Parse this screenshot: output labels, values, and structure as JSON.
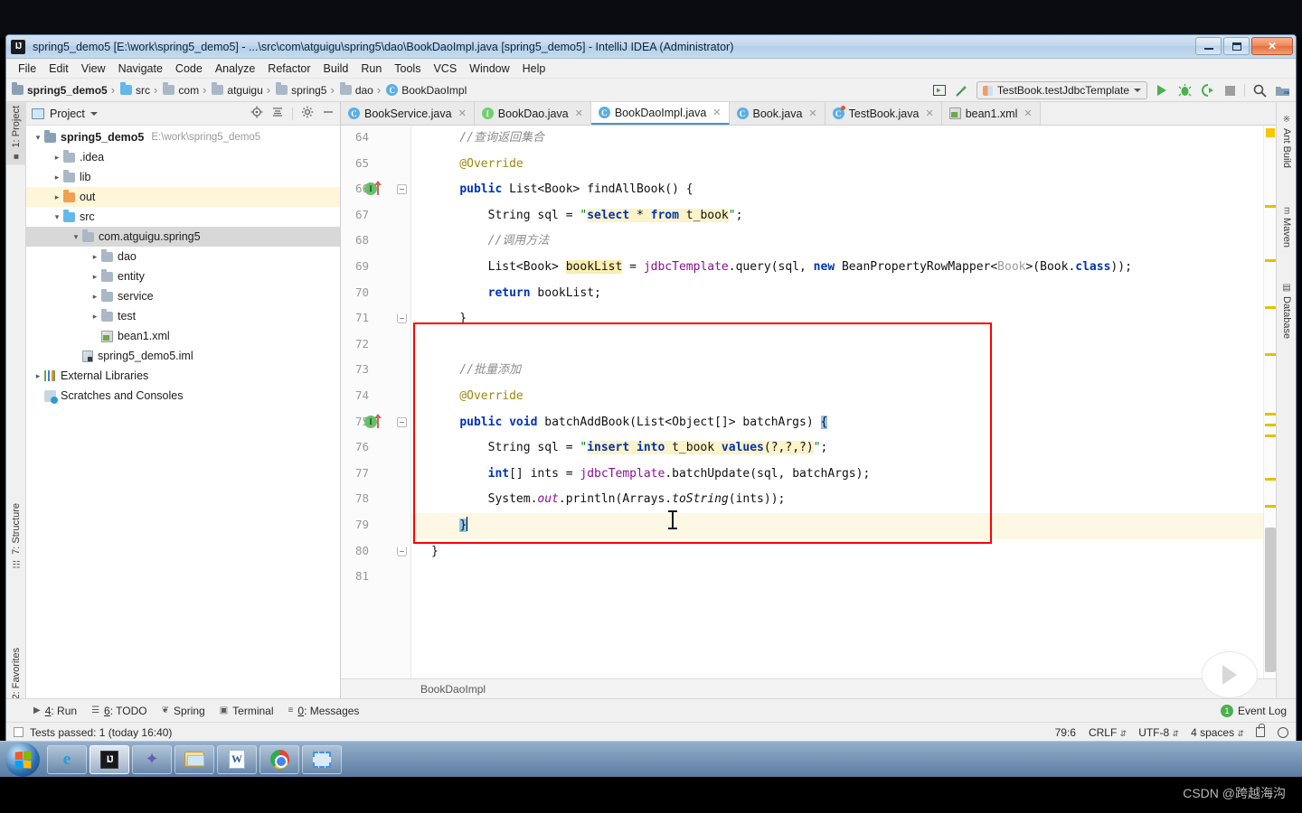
{
  "window": {
    "title": "spring5_demo5 [E:\\work\\spring5_demo5] - ...\\src\\com\\atguigu\\spring5\\dao\\BookDaoImpl.java [spring5_demo5] - IntelliJ IDEA (Administrator)",
    "logo_text": "IJ",
    "minimize_label": "–",
    "maximize_label": "❐",
    "close_label": "✕"
  },
  "menubar": {
    "items": [
      "File",
      "Edit",
      "View",
      "Navigate",
      "Code",
      "Analyze",
      "Refactor",
      "Build",
      "Run",
      "Tools",
      "VCS",
      "Window",
      "Help"
    ]
  },
  "breadcrumb": {
    "items": [
      {
        "label": "spring5_demo5",
        "icon": "project-module-icon"
      },
      {
        "label": "src",
        "icon": "source-folder-icon"
      },
      {
        "label": "com",
        "icon": "package-icon"
      },
      {
        "label": "atguigu",
        "icon": "package-icon"
      },
      {
        "label": "spring5",
        "icon": "package-icon"
      },
      {
        "label": "dao",
        "icon": "package-icon"
      },
      {
        "label": "BookDaoImpl",
        "icon": "class-icon"
      }
    ]
  },
  "toolbar": {
    "run_config": "TestBook.testJdbcTemplate",
    "run_tooltip": "Run",
    "debug_tooltip": "Debug",
    "coverage_tooltip": "Run with Coverage",
    "stop_tooltip": "Stop",
    "search_tooltip": "Search Everywhere",
    "project_structure_tooltip": "Project Structure"
  },
  "left_strip": {
    "items": [
      "1: Project",
      "7: Structure",
      "2: Favorites"
    ]
  },
  "right_strip": {
    "items": [
      "Ant Build",
      "Maven",
      "Database"
    ]
  },
  "project_panel": {
    "title": "Project",
    "actions": [
      "locate-icon",
      "collapse-all-icon",
      "settings-icon",
      "hide-icon"
    ],
    "tree": [
      {
        "label": "spring5_demo5",
        "sub": "E:\\work\\spring5_demo5",
        "arrow": "v",
        "indent": 0,
        "icon": "module-icon",
        "bold": true,
        "state": "normal"
      },
      {
        "label": ".idea",
        "sub": "",
        "arrow": ">",
        "indent": 1,
        "icon": "folder-gray",
        "bold": false,
        "state": "normal"
      },
      {
        "label": "lib",
        "sub": "",
        "arrow": ">",
        "indent": 1,
        "icon": "folder-gray",
        "bold": false,
        "state": "normal"
      },
      {
        "label": "out",
        "sub": "",
        "arrow": ">",
        "indent": 1,
        "icon": "folder-orange",
        "bold": false,
        "state": "highlight"
      },
      {
        "label": "src",
        "sub": "",
        "arrow": "v",
        "indent": 1,
        "icon": "folder-blue",
        "bold": false,
        "state": "normal"
      },
      {
        "label": "com.atguigu.spring5",
        "sub": "",
        "arrow": "v",
        "indent": 2,
        "icon": "package-icon",
        "bold": false,
        "state": "selected"
      },
      {
        "label": "dao",
        "sub": "",
        "arrow": ">",
        "indent": 3,
        "icon": "package-icon",
        "bold": false,
        "state": "normal"
      },
      {
        "label": "entity",
        "sub": "",
        "arrow": ">",
        "indent": 3,
        "icon": "package-icon",
        "bold": false,
        "state": "normal"
      },
      {
        "label": "service",
        "sub": "",
        "arrow": ">",
        "indent": 3,
        "icon": "package-icon",
        "bold": false,
        "state": "normal"
      },
      {
        "label": "test",
        "sub": "",
        "arrow": ">",
        "indent": 3,
        "icon": "package-icon",
        "bold": false,
        "state": "normal"
      },
      {
        "label": "bean1.xml",
        "sub": "",
        "arrow": "",
        "indent": 3,
        "icon": "xml-icon",
        "bold": false,
        "state": "normal"
      },
      {
        "label": "spring5_demo5.iml",
        "sub": "",
        "arrow": "",
        "indent": 2,
        "icon": "iml-icon",
        "bold": false,
        "state": "normal"
      },
      {
        "label": "External Libraries",
        "sub": "",
        "arrow": ">",
        "indent": 0,
        "icon": "libraries-icon",
        "bold": false,
        "state": "normal"
      },
      {
        "label": "Scratches and Consoles",
        "sub": "",
        "arrow": "",
        "indent": 0,
        "icon": "scratches-icon",
        "bold": false,
        "state": "normal"
      }
    ]
  },
  "editor": {
    "tabs": [
      {
        "label": "BookService.java",
        "icon": "class-icon",
        "active": false
      },
      {
        "label": "BookDao.java",
        "icon": "interface-icon",
        "active": false
      },
      {
        "label": "BookDaoImpl.java",
        "icon": "class-icon",
        "active": true
      },
      {
        "label": "Book.java",
        "icon": "class-icon",
        "active": false
      },
      {
        "label": "TestBook.java",
        "icon": "test-class-icon",
        "active": false
      },
      {
        "label": "bean1.xml",
        "icon": "xml-icon",
        "active": false
      }
    ],
    "breadcrumb_bottom": "BookDaoImpl",
    "line_numbers": [
      "64",
      "65",
      "66",
      "67",
      "68",
      "69",
      "70",
      "71",
      "72",
      "73",
      "74",
      "75",
      "76",
      "77",
      "78",
      "79",
      "80",
      "81"
    ],
    "lines": [
      {
        "n": "64",
        "text": "    //查询返回集合"
      },
      {
        "n": "65",
        "text": "    @Override"
      },
      {
        "n": "66",
        "text": "    public List<Book> findAllBook() {"
      },
      {
        "n": "67",
        "text": "        String sql = \"select * from t_book\";"
      },
      {
        "n": "68",
        "text": "        //调用方法"
      },
      {
        "n": "69",
        "text": "        List<Book> bookList = jdbcTemplate.query(sql, new BeanPropertyRowMapper<Book>(Book.class));"
      },
      {
        "n": "70",
        "text": "        return bookList;"
      },
      {
        "n": "71",
        "text": "    }"
      },
      {
        "n": "72",
        "text": ""
      },
      {
        "n": "73",
        "text": "    //批量添加"
      },
      {
        "n": "74",
        "text": "    @Override"
      },
      {
        "n": "75",
        "text": "    public void batchAddBook(List<Object[]> batchArgs) {"
      },
      {
        "n": "76",
        "text": "        String sql = \"insert into t_book values(?,?,?)\";"
      },
      {
        "n": "77",
        "text": "        int[] ints = jdbcTemplate.batchUpdate(sql, batchArgs);"
      },
      {
        "n": "78",
        "text": "        System.out.println(Arrays.toString(ints));"
      },
      {
        "n": "79",
        "text": "    }"
      },
      {
        "n": "80",
        "text": "}"
      },
      {
        "n": "81",
        "text": ""
      }
    ],
    "annotation_color": "#9e880d",
    "keyword_color": "#0033b3",
    "comment_color": "#8c8c8c",
    "string_highlight_color": "#fdf3c9",
    "red_box_color": "#ff0000"
  },
  "bottom_strip": {
    "items": [
      {
        "key": "4",
        "label": "Run",
        "icon": "run-icon"
      },
      {
        "key": "6",
        "label": "TODO",
        "icon": "todo-icon"
      },
      {
        "key": "",
        "label": "Spring",
        "icon": "spring-leaf-icon"
      },
      {
        "key": "",
        "label": "Terminal",
        "icon": "terminal-icon"
      },
      {
        "key": "0",
        "label": "Messages",
        "icon": "messages-icon"
      }
    ],
    "event_log": "Event Log",
    "event_count": "1"
  },
  "statusbar": {
    "message": "Tests passed: 1 (today 16:40)",
    "caret": "79:6",
    "line_separator": "CRLF",
    "encoding": "UTF-8",
    "indent": "4 spaces",
    "lock_tooltip": "Make file read-only",
    "browser_tooltip": "Show in browser"
  },
  "taskbar": {
    "start_tooltip": "Start",
    "buttons": [
      {
        "name": "internet-explorer",
        "glyph": "e"
      },
      {
        "name": "intellij-idea",
        "glyph": "IJ"
      },
      {
        "name": "navicat",
        "glyph": "N"
      },
      {
        "name": "file-explorer",
        "glyph": ""
      },
      {
        "name": "microsoft-word",
        "glyph": "W"
      },
      {
        "name": "google-chrome",
        "glyph": ""
      },
      {
        "name": "snipping-tool",
        "glyph": ""
      }
    ]
  },
  "watermark": "CSDN @跨越海沟"
}
